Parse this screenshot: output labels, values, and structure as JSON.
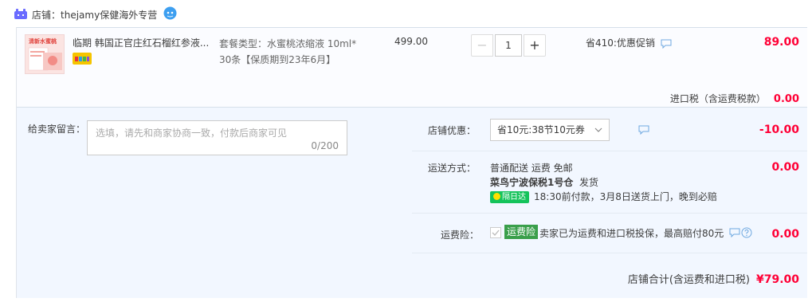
{
  "shop": {
    "label": "店铺：",
    "name": "thejamy保健海外专营"
  },
  "item": {
    "thumb_text": "清新水蜜桃",
    "title": "临期 韩国正官庄红石榴红参液...",
    "spec_line1": "套餐类型：水蜜桃浓缩液 10ml*",
    "spec_line2": "30条【保质期到23年6月】",
    "unit_price": "499.00",
    "quantity": "1",
    "minus": "−",
    "plus": "+",
    "promo": "省410:优惠促销",
    "total": "89.00"
  },
  "tax": {
    "label": "进口税（含运费税款）",
    "value": "0.00"
  },
  "memo": {
    "label": "给卖家留言：",
    "placeholder": "选填，请先和商家协商一致，付款后商家可见",
    "count": "0/200"
  },
  "shop_discount": {
    "label": "店铺优惠：",
    "selected": "省10元:38节10元券",
    "value": "-10.00"
  },
  "shipping": {
    "label": "运送方式：",
    "method": "普通配送 运费 免邮",
    "warehouse": "菜鸟宁波保税1号仓",
    "warehouse_suffix": "发货",
    "badge": "隔日达",
    "eta": "18:30前付款，3月8日送货上门，晚到必赔",
    "value": "0.00"
  },
  "insurance": {
    "label": "运费险：",
    "badge": "运费险",
    "text": "卖家已为运费和进口税投保，最高赔付80元",
    "value": "0.00"
  },
  "grand_total": {
    "label": "店铺合计(含运费和进口税)",
    "value": "¥79.00"
  },
  "colors": {
    "accent_red": "#ff0036",
    "shop_icon": "#6a6bff",
    "ww_icon": "#3d9ff0",
    "insurance_green": "#3a9f4b",
    "next_day_green": "#14c35b"
  }
}
